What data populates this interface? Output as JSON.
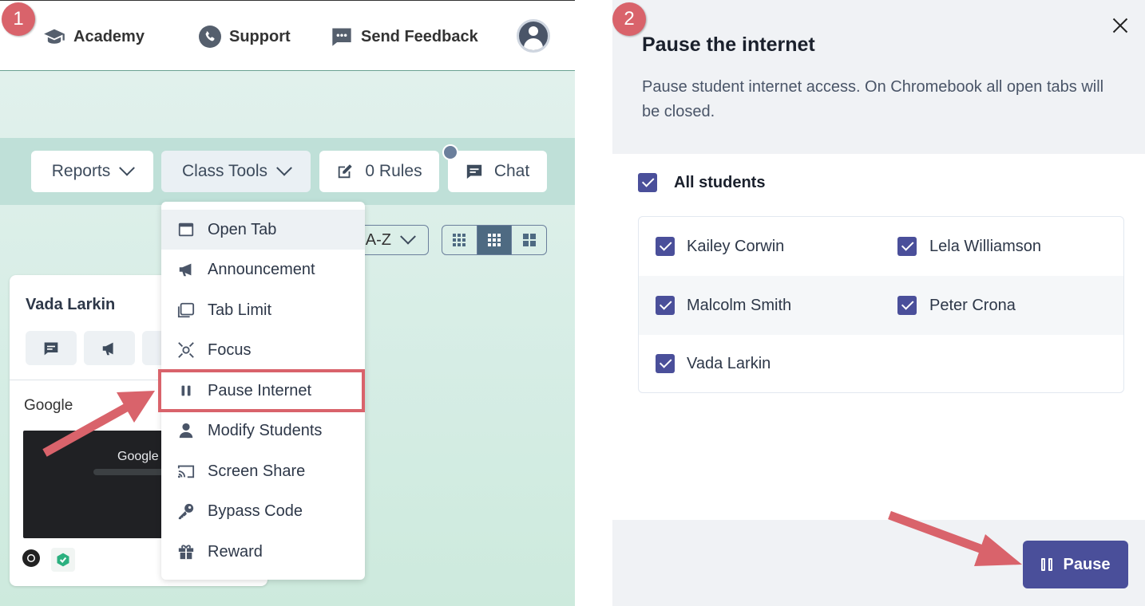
{
  "topnav": {
    "academy_label": "Academy",
    "support_label": "Support",
    "feedback_label": "Send Feedback"
  },
  "toolbar": {
    "reports_label": "Reports",
    "class_tools_label": "Class Tools",
    "rules_label": "0 Rules",
    "chat_label": "Chat"
  },
  "sort": {
    "label": "A-Z"
  },
  "student_card": {
    "name": "Vada Larkin",
    "site": "Google",
    "thumbnail_text": "Google"
  },
  "menu": {
    "items": [
      {
        "label": "Open Tab",
        "icon": "browser-tab-icon"
      },
      {
        "label": "Announcement",
        "icon": "megaphone-icon"
      },
      {
        "label": "Tab Limit",
        "icon": "tab-limit-icon"
      },
      {
        "label": "Focus",
        "icon": "focus-icon"
      },
      {
        "label": "Pause Internet",
        "icon": "pause-icon"
      },
      {
        "label": "Modify Students",
        "icon": "person-icon"
      },
      {
        "label": "Screen Share",
        "icon": "cast-icon"
      },
      {
        "label": "Bypass Code",
        "icon": "key-icon"
      },
      {
        "label": "Reward",
        "icon": "gift-icon"
      }
    ]
  },
  "steps": {
    "one": "1",
    "two": "2"
  },
  "dialog": {
    "title": "Pause the internet",
    "description": "Pause student internet access. On Chromebook all open tabs will be closed.",
    "all_label": "All students",
    "students": [
      "Kailey Corwin",
      "Lela Williamson",
      "Malcolm Smith",
      "Peter Crona",
      "Vada Larkin"
    ],
    "pause_label": "Pause"
  },
  "colors": {
    "accent": "#4a4f9a",
    "annotation": "#d9636b",
    "teal_bg": "#bfe0d8"
  }
}
